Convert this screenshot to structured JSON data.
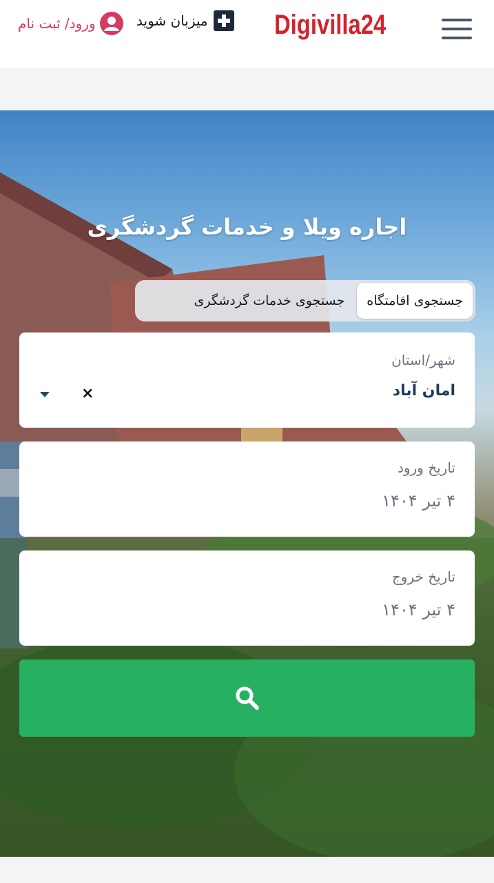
{
  "header": {
    "logo_text": "Digivilla24",
    "host_label": "میزبان شوید",
    "login_label": "ورود/ ثبت نام"
  },
  "hero": {
    "title": "اجاره ویلا و خدمات گردشگری",
    "tabs": [
      {
        "label": "جستجوی اقامتگاه",
        "active": true
      },
      {
        "label": "جستجوی خدمات گردشگری",
        "active": false
      }
    ]
  },
  "search": {
    "city_label": "شهر/استان",
    "city_value": "امان آباد",
    "clear_symbol": "×",
    "checkin_label": "تاریخ ورود",
    "checkin_value": "۴ تیر ۱۴۰۴",
    "checkout_label": "تاریخ خروج",
    "checkout_value": "۴ تیر ۱۴۰۴",
    "button_icon": "search-icon"
  },
  "colors": {
    "brand_red": "#d4232c",
    "login_pink": "#d63b5e",
    "search_green": "#28b062",
    "city_text": "#1e3a5f"
  }
}
